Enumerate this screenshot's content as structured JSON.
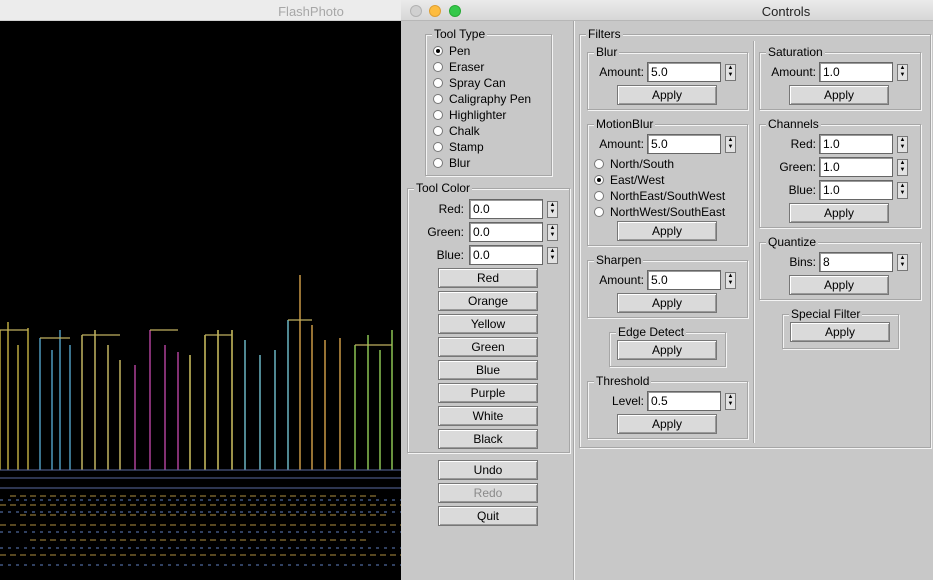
{
  "photo_window": {
    "title": "FlashPhoto"
  },
  "controls_window": {
    "title": "Controls"
  },
  "tool_type": {
    "label": "Tool Type",
    "options": [
      "Pen",
      "Eraser",
      "Spray Can",
      "Caligraphy Pen",
      "Highlighter",
      "Chalk",
      "Stamp",
      "Blur"
    ],
    "selected": "Pen"
  },
  "tool_color": {
    "label": "Tool Color",
    "red_label": "Red:",
    "red": "0.0",
    "green_label": "Green:",
    "green": "0.0",
    "blue_label": "Blue:",
    "blue": "0.0",
    "presets": [
      "Red",
      "Orange",
      "Yellow",
      "Green",
      "Blue",
      "Purple",
      "White",
      "Black"
    ]
  },
  "actions": {
    "undo": "Undo",
    "redo": "Redo",
    "quit": "Quit"
  },
  "filters": {
    "label": "Filters",
    "apply": "Apply",
    "blur": {
      "label": "Blur",
      "amount_label": "Amount:",
      "amount": "5.0"
    },
    "motion_blur": {
      "label": "MotionBlur",
      "amount_label": "Amount:",
      "amount": "5.0",
      "directions": [
        "North/South",
        "East/West",
        "NorthEast/SouthWest",
        "NorthWest/SouthEast"
      ],
      "selected": "East/West"
    },
    "sharpen": {
      "label": "Sharpen",
      "amount_label": "Amount:",
      "amount": "5.0"
    },
    "edge_detect": {
      "label": "Edge Detect"
    },
    "threshold": {
      "label": "Threshold",
      "level_label": "Level:",
      "level": "0.5"
    },
    "saturation": {
      "label": "Saturation",
      "amount_label": "Amount:",
      "amount": "1.0"
    },
    "channels": {
      "label": "Channels",
      "red_label": "Red:",
      "red": "1.0",
      "green_label": "Green:",
      "green": "1.0",
      "blue_label": "Blue:",
      "blue": "1.0"
    },
    "quantize": {
      "label": "Quantize",
      "bins_label": "Bins:",
      "bins": "8"
    },
    "special": {
      "label": "Special Filter"
    }
  },
  "colors": {
    "close": "#fc615d",
    "minimize": "#fdbc40",
    "zoom": "#34c84a",
    "panel": "#c8c8c8",
    "canvas": "#000000"
  }
}
